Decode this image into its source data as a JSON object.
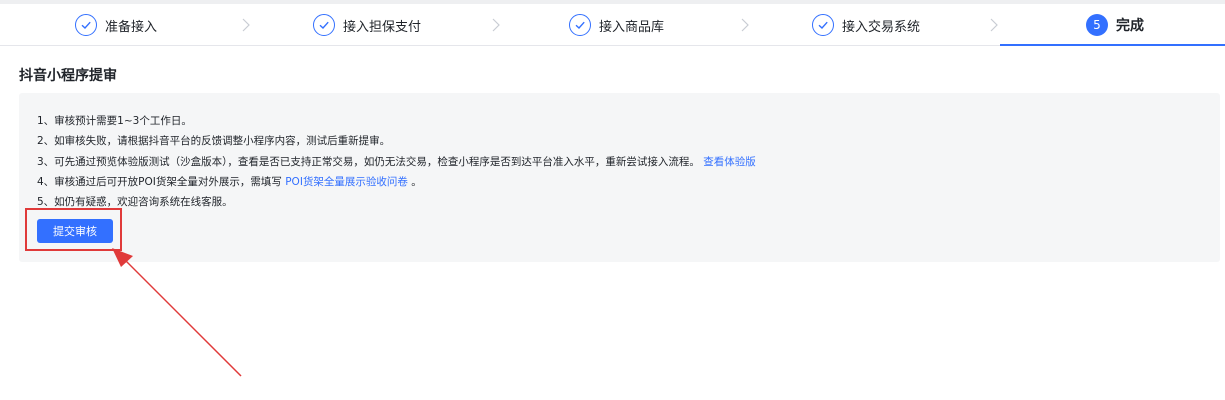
{
  "steps": [
    {
      "label": "准备接入",
      "status": "done"
    },
    {
      "label": "接入担保支付",
      "status": "done"
    },
    {
      "label": "接入商品库",
      "status": "done"
    },
    {
      "label": "接入交易系统",
      "status": "done"
    },
    {
      "label": "完成",
      "status": "active",
      "number": "5"
    }
  ],
  "section_title": "抖音小程序提审",
  "notes": [
    {
      "text": "1、审核预计需要1~3个工作日。"
    },
    {
      "text": "2、如审核失败，请根据抖音平台的反馈调整小程序内容，测试后重新提审。"
    },
    {
      "text": "3、可先通过预览体验版测试（沙盒版本），查看是否已支持正常交易，如仍无法交易，检查小程序是否到达平台准入水平，重新尝试接入流程。",
      "link": "查看体验版"
    },
    {
      "text": "4、审核通过后可开放POI货架全量对外展示，需填写",
      "link": "POI货架全量展示验收问卷",
      "suffix": "。"
    },
    {
      "text": "5、如仍有疑惑，欢迎咨询系统在线客服。"
    }
  ],
  "submit_label": "提交审核",
  "colors": {
    "accent": "#3370ff",
    "annotation": "#e03a3a"
  }
}
